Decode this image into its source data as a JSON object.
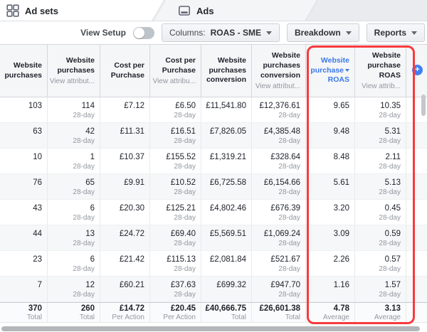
{
  "tabs": [
    {
      "label": "Ad sets"
    },
    {
      "label": "Ads"
    }
  ],
  "toolbar": {
    "view_setup_label": "View Setup",
    "columns_label": "Columns:",
    "columns_value": "ROAS - SME",
    "breakdown_label": "Breakdown",
    "reports_label": "Reports"
  },
  "table": {
    "attribution_window": "28-day",
    "columns": [
      {
        "title": "Website purchases",
        "sub": ""
      },
      {
        "title": "Website purchases",
        "sub": "View attribut..."
      },
      {
        "title": "Cost per Purchase",
        "sub": ""
      },
      {
        "title": "Cost per Purchase",
        "sub": "View attribu..."
      },
      {
        "title": "Website purchases conversion",
        "sub": ""
      },
      {
        "title": "Website purchases conversion",
        "sub": "View attribut..."
      },
      {
        "title_line1": "Website purchase",
        "title_line2": "ROAS",
        "sorted": true
      },
      {
        "title": "Website purchase ROAS",
        "sub": "View attrib..."
      }
    ],
    "rows": [
      [
        "103",
        "114",
        "£7.12",
        "£6.50",
        "£11,541.80",
        "£12,376.61",
        "9.65",
        "10.35"
      ],
      [
        "63",
        "42",
        "£11.31",
        "£16.51",
        "£7,826.05",
        "£4,385.48",
        "9.48",
        "5.31"
      ],
      [
        "10",
        "1",
        "£10.37",
        "£155.52",
        "£1,319.21",
        "£328.64",
        "8.48",
        "2.11"
      ],
      [
        "76",
        "65",
        "£9.91",
        "£10.52",
        "£6,725.58",
        "£6,154.66",
        "5.61",
        "5.13"
      ],
      [
        "43",
        "6",
        "£20.30",
        "£125.21",
        "£4,802.46",
        "£676.39",
        "3.20",
        "0.45"
      ],
      [
        "44",
        "13",
        "£24.72",
        "£69.40",
        "£5,569.51",
        "£1,069.24",
        "3.09",
        "0.59"
      ],
      [
        "23",
        "6",
        "£21.42",
        "£115.13",
        "£2,081.84",
        "£521.67",
        "2.26",
        "0.57"
      ],
      [
        "7",
        "12",
        "£60.21",
        "£37.63",
        "£699.32",
        "£947.70",
        "1.16",
        "1.57"
      ]
    ],
    "footer": {
      "values": [
        "370",
        "260",
        "£14.72",
        "£20.45",
        "£40,666.75",
        "£26,601.38",
        "4.78",
        "3.13"
      ],
      "labels": [
        "Total",
        "Total",
        "Per Action",
        "Per Action",
        "Total",
        "Total",
        "Average",
        "Average"
      ]
    },
    "add_column_label": "+"
  },
  "colors": {
    "accent_blue": "#3b78e8",
    "highlight_red": "#f83a3d"
  }
}
